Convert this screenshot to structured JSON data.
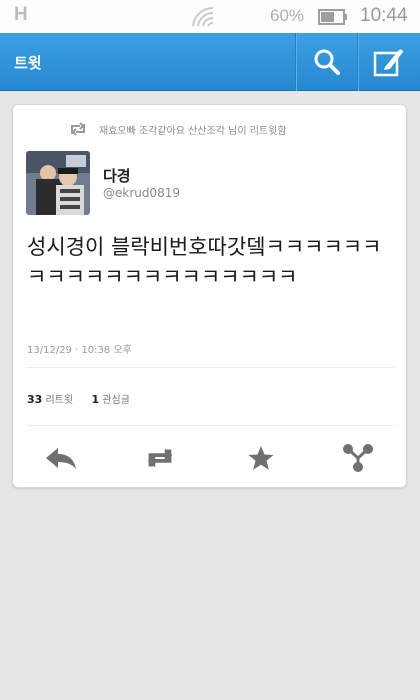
{
  "status_bar": {
    "carrier_glyph": "H",
    "battery_percent": "60%",
    "time": "10:44"
  },
  "app_bar": {
    "title": "트윗",
    "icons": [
      "search-icon",
      "compose-icon"
    ]
  },
  "tweet": {
    "retweeted_by": "재효오빠 조각같아요 산산조각 님이 리트윗함",
    "author_name": "다경",
    "author_handle": "@ekrud0819",
    "text": "성시경이 블락비번호따갓뎈ㅋㅋㅋㅋㅋㅋㅋㅋㅋㅋㅋㅋㅋㅋㅋㅋㅋㅋㅋㅋ",
    "timestamp": "13/12/29 · 10:38 오후",
    "retweet_count": "33",
    "retweet_label": "리트윗",
    "favorite_count": "1",
    "favorite_label": "관심글"
  },
  "actions": [
    "reply-icon",
    "retweet-icon",
    "favorite-icon",
    "more-icon"
  ],
  "colors": {
    "accent": "#2a8ed6",
    "background": "#e6e6e6",
    "icon_gray": "#707070"
  }
}
